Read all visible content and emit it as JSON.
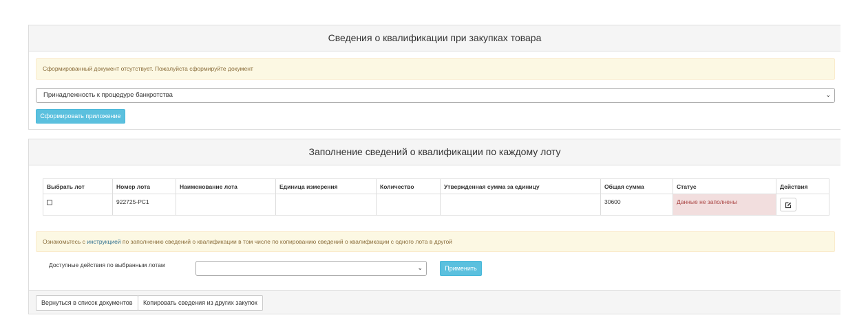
{
  "qualification_panel": {
    "title": "Сведения о квалификации при закупках товара",
    "alert_text": "Сформированный документ отсутствует. Пожалуйста сформируйте документ",
    "bankruptcy_select_value": "Принадлежность к процедуре банкротства",
    "generate_button_label": "Сформировать приложение"
  },
  "lots_panel": {
    "title": "Заполнение сведений о квалификации по каждому лоту",
    "table": {
      "columns": [
        "Выбрать лот",
        "Номер лота",
        "Наименование лота",
        "Единица измерения",
        "Количество",
        "Утвержденная сумма за единицу",
        "Общая сумма",
        "Статус",
        "Действия"
      ],
      "rows": [
        {
          "lot_number": "922725-РС1",
          "lot_name": "",
          "unit": "",
          "quantity": "",
          "unit_price": "",
          "total": "30600",
          "status": "Данные не заполнены"
        }
      ]
    },
    "info_prefix": "Ознакомьтесь с ",
    "info_link": "инструкцией",
    "info_suffix": " по заполнению сведений о квалификации в том числе по копированию сведений о квалификации с одного лота в другой",
    "actions_label": "Доступные действия по выбранным лотам",
    "actions_select_value": "",
    "apply_button_label": "Применить",
    "back_button_label": "Вернуться в список документов",
    "copy_button_label": "Копировать сведения из других закупок"
  },
  "icons": {
    "dropdown": "chevron-down-icon",
    "edit": "edit-icon"
  },
  "colors": {
    "info_button": "#5bc0de",
    "warning_bg": "#fcf8e3",
    "danger_bg": "#f2dede",
    "panel_heading": "#f5f5f5",
    "link": "#31708f"
  }
}
